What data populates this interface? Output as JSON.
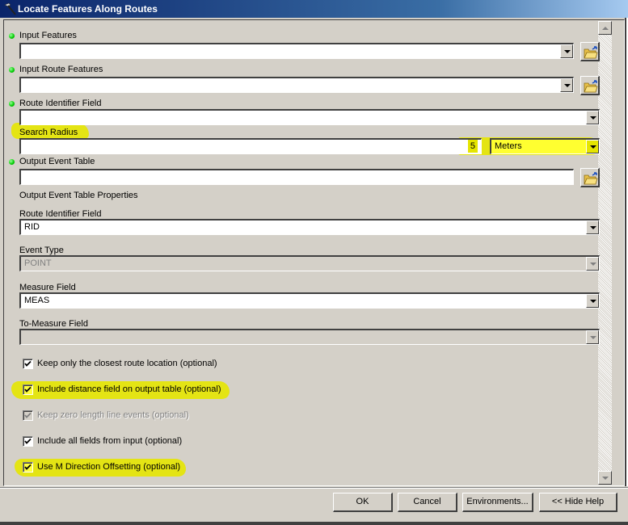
{
  "window": {
    "title": "Locate Features Along Routes",
    "icon": "hammer-icon"
  },
  "params": {
    "input_features": {
      "label": "Input Features",
      "value": "",
      "required": true
    },
    "input_route_features": {
      "label": "Input Route Features",
      "value": "",
      "required": true
    },
    "route_identifier_field": {
      "label": "Route Identifier Field",
      "value": "",
      "required": true
    },
    "search_radius": {
      "label": "Search Radius",
      "value": "5",
      "unit": "Meters",
      "required": false
    },
    "output_event_table": {
      "label": "Output Event Table",
      "value": "",
      "required": true
    },
    "output_props_heading": "Output Event Table Properties",
    "props": {
      "route_id_field": {
        "label": "Route Identifier Field",
        "value": "RID"
      },
      "event_type": {
        "label": "Event Type",
        "value": "POINT",
        "disabled": true
      },
      "measure_field": {
        "label": "Measure Field",
        "value": "MEAS"
      },
      "to_measure_field": {
        "label": "To-Measure Field",
        "value": "",
        "disabled": true
      }
    }
  },
  "options": [
    {
      "label": "Keep only the closest route location (optional)",
      "checked": true,
      "disabled": false,
      "highlighted": false
    },
    {
      "label": "Include distance field on output table (optional)",
      "checked": true,
      "disabled": false,
      "highlighted": true
    },
    {
      "label": "Keep zero length line events (optional)",
      "checked": true,
      "disabled": true,
      "highlighted": false
    },
    {
      "label": "Include all fields from input (optional)",
      "checked": true,
      "disabled": false,
      "highlighted": false
    },
    {
      "label": "Use M Direction Offsetting (optional)",
      "checked": true,
      "disabled": false,
      "highlighted": true
    }
  ],
  "buttons": {
    "ok": "OK",
    "cancel": "Cancel",
    "environments": "Environments...",
    "hide_help": "<< Hide Help"
  },
  "colors": {
    "highlight": "#e5e500",
    "required_dot": "#00cc00",
    "titlebar": "#0a246a"
  }
}
